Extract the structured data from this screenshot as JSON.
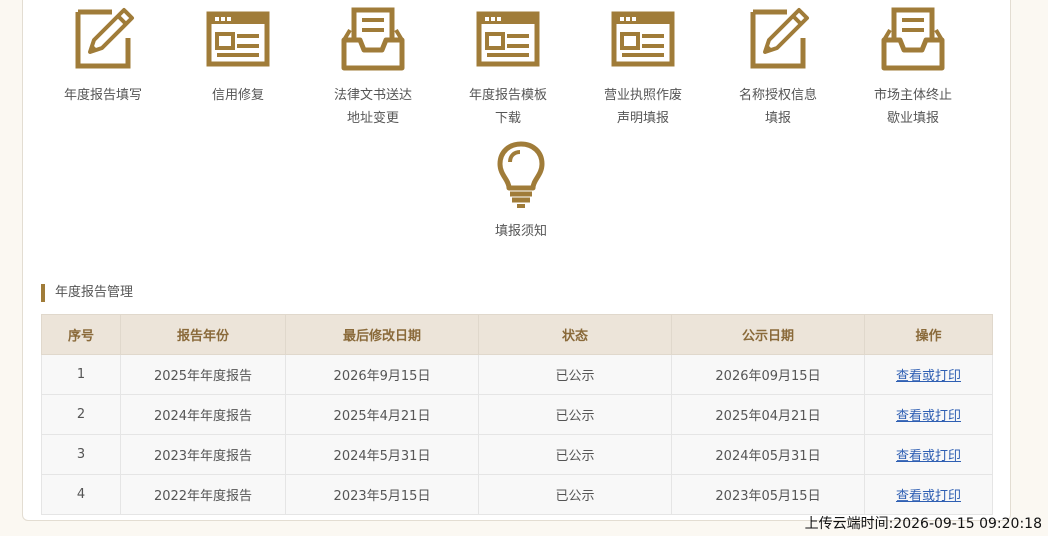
{
  "colors": {
    "accent": "#a07c39",
    "header_bg": "#ece4d9",
    "link": "#2f5fb3"
  },
  "icons": [
    {
      "label": "年度报告填写",
      "icon": "edit-icon"
    },
    {
      "label": "信用修复",
      "icon": "form-icon"
    },
    {
      "label": "法律文书送达\n地址变更",
      "icon": "inbox-icon"
    },
    {
      "label": "年度报告模板\n下载",
      "icon": "form-icon"
    },
    {
      "label": "营业执照作废\n声明填报",
      "icon": "form-icon"
    },
    {
      "label": "名称授权信息\n填报",
      "icon": "edit-icon"
    },
    {
      "label": "市场主体终止\n歇业填报",
      "icon": "inbox-icon"
    },
    {
      "label": "填报须知",
      "icon": "lightbulb-icon"
    }
  ],
  "section_title": "年度报告管理",
  "table": {
    "headers": [
      "序号",
      "报告年份",
      "最后修改日期",
      "状态",
      "公示日期",
      "操作"
    ],
    "rows": [
      [
        "1",
        "2025年年度报告",
        "2026年9月15日",
        "已公示",
        "2026年09月15日",
        "查看或打印"
      ],
      [
        "2",
        "2024年年度报告",
        "2025年4月21日",
        "已公示",
        "2025年04月21日",
        "查看或打印"
      ],
      [
        "3",
        "2023年年度报告",
        "2024年5月31日",
        "已公示",
        "2024年05月31日",
        "查看或打印"
      ],
      [
        "4",
        "2022年年度报告",
        "2023年5月15日",
        "已公示",
        "2023年05月15日",
        "查看或打印"
      ]
    ]
  },
  "upload_time": "上传云端时间:2026-09-15 09:20:18"
}
